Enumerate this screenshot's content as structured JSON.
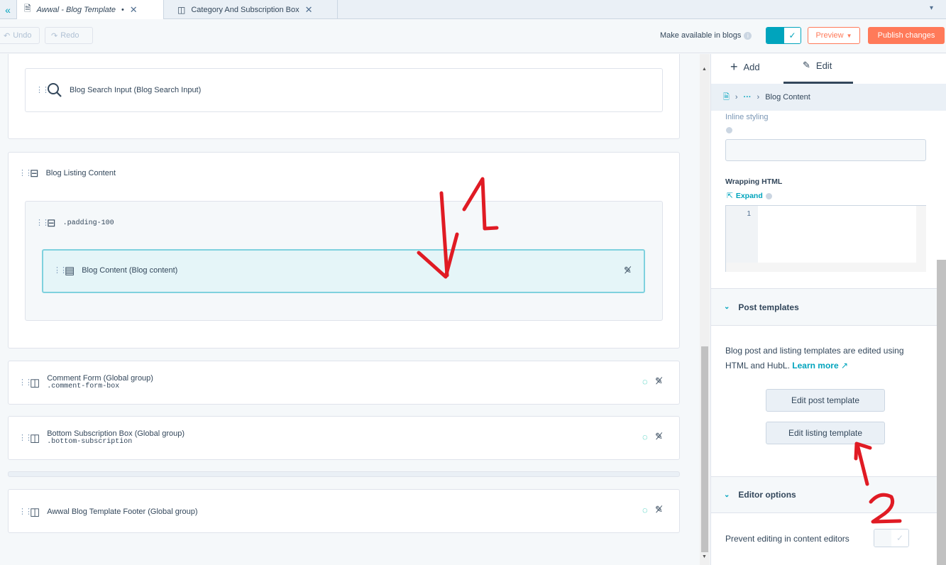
{
  "tabs": [
    {
      "label": "Awwal - Blog Template",
      "dirty": "•",
      "close": "✕"
    },
    {
      "label": "Category And Subscription Box",
      "close": "✕"
    }
  ],
  "toolbar": {
    "undo": "Undo",
    "redo": "Redo",
    "make_available": "Make available in blogs",
    "preview": "Preview",
    "publish": "Publish changes"
  },
  "canvas": {
    "search_module": "Blog Search Input (Blog Search Input)",
    "listing_group": "Blog Listing Content",
    "padding_group": ".padding-100",
    "blog_content": "Blog Content (Blog content)",
    "comment_title": "Comment Form (Global group)",
    "comment_class": ".comment-form-box",
    "subscription_title": "Bottom Subscription Box (Global group)",
    "subscription_class": ".bottom-subscription",
    "footer_title": "Awwal Blog Template Footer (Global group)"
  },
  "panel": {
    "add_tab": "Add",
    "edit_tab": "Edit",
    "breadcrumb_more": "···",
    "breadcrumb_current": "Blog Content",
    "inline_styling": "Inline styling",
    "wrapping_html": "Wrapping HTML",
    "expand": "Expand",
    "line_number": "1",
    "post_templates": "Post templates",
    "post_templates_desc": "Blog post and listing templates are edited using HTML and HubL.",
    "learn_more": "Learn more",
    "edit_post_template": "Edit post template",
    "edit_listing_template": "Edit listing template",
    "editor_options": "Editor options",
    "prevent_editing": "Prevent editing in content editors"
  },
  "annotations": {
    "mark_1": "1",
    "mark_2": "2"
  },
  "colors": {
    "accent": "#00a4bd",
    "publish": "#ff7a59",
    "annotation": "#e01b24",
    "selected_bg": "#e5f5f8"
  }
}
